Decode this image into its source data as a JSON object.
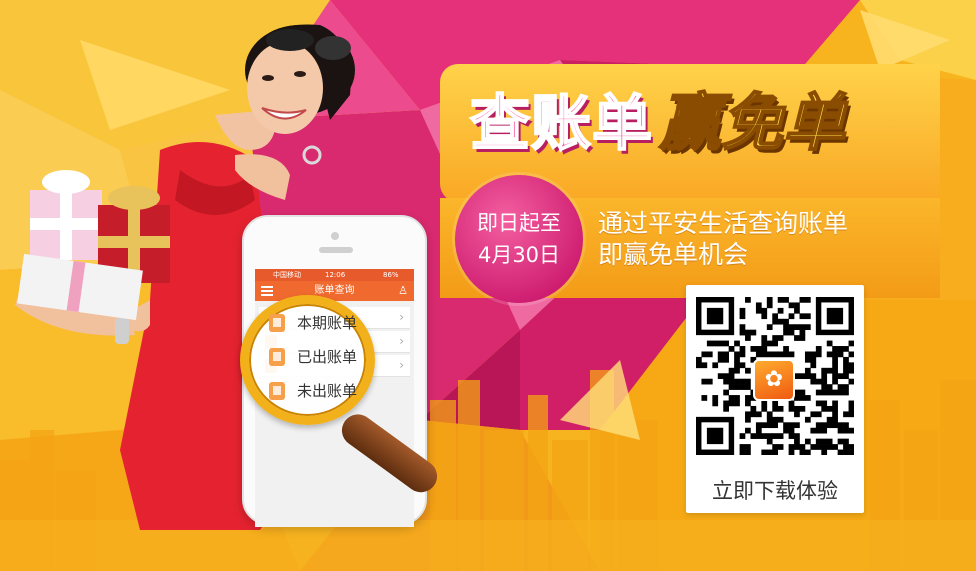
{
  "headline": {
    "part1": "查账单",
    "part2": "赢免单"
  },
  "date_badge": {
    "line1": "即日起至",
    "line2": "4月30日"
  },
  "description": {
    "line1": "通过平安生活查询账单",
    "line2": "即赢免单机会"
  },
  "qr": {
    "caption": "立即下载体验"
  },
  "phone": {
    "status_carrier": "中国移动",
    "status_time": "12:06",
    "status_battery": "86%",
    "nav_title": "账单查询"
  },
  "magnifier": {
    "items": [
      {
        "label": "本期账单"
      },
      {
        "label": "已出账单"
      },
      {
        "label": "未出账单"
      }
    ]
  },
  "colors": {
    "background": "#f7b21c",
    "pink": "#e2337c",
    "orange_bar": "#f06a2f",
    "gold": "#f2b01a"
  }
}
